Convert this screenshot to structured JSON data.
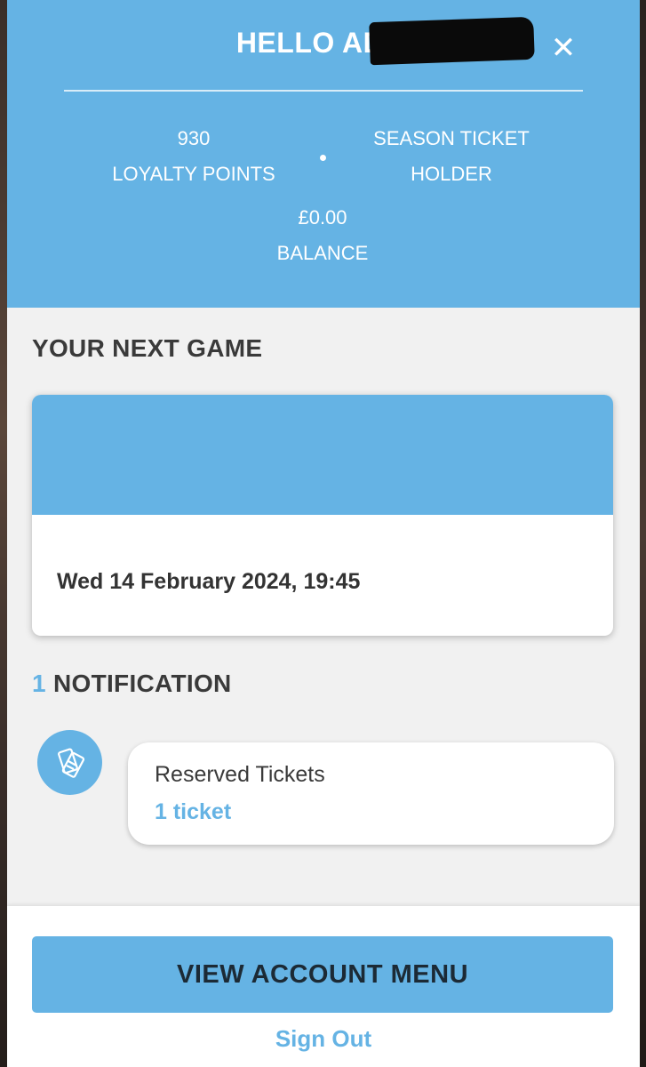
{
  "header": {
    "greeting": "HELLO AD",
    "close_icon": "close-icon",
    "stats": {
      "loyalty_points_value": "930",
      "loyalty_points_label": "LOYALTY POINTS",
      "holder_line1": "SEASON TICKET",
      "holder_line2": "HOLDER",
      "balance_value": "£0.00",
      "balance_label": "BALANCE"
    }
  },
  "next_game": {
    "title": "YOUR NEXT GAME",
    "date": "Wed 14 February 2024, 19:45"
  },
  "notifications": {
    "count": "1",
    "title": "NOTIFICATION",
    "icon": "tickets-icon",
    "items": [
      {
        "title": "Reserved Tickets",
        "subtitle": "1 ticket"
      }
    ]
  },
  "footer": {
    "menu_button": "VIEW ACCOUNT MENU",
    "sign_out": "Sign Out"
  },
  "colors": {
    "accent": "#65b3e4",
    "background": "#f1f1f1",
    "text_dark": "#3a3a3a"
  }
}
